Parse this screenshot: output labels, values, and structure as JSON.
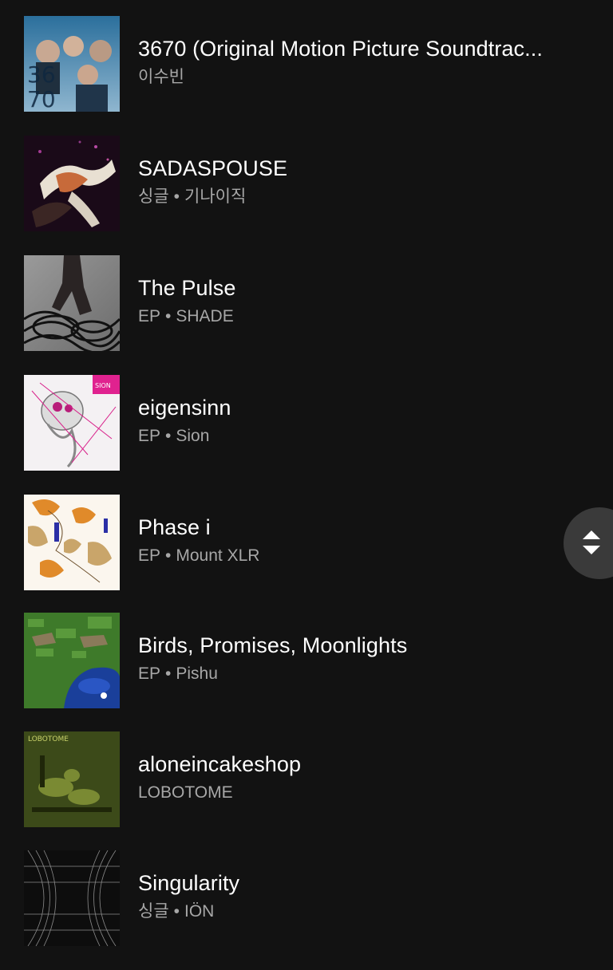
{
  "albums": [
    {
      "title": "3670 (Original Motion Picture Soundtrac...",
      "type": "",
      "artist": "이수빈",
      "cover_icon": "album-cover-3670"
    },
    {
      "title": "SADASPOUSE",
      "type": "싱글",
      "artist": "기나이직",
      "cover_icon": "album-cover-sadaspouse"
    },
    {
      "title": "The Pulse",
      "type": "EP",
      "artist": "SHADE",
      "cover_icon": "album-cover-the-pulse"
    },
    {
      "title": "eigensinn",
      "type": "EP",
      "artist": "Sion",
      "cover_icon": "album-cover-eigensinn"
    },
    {
      "title": "Phase i",
      "type": "EP",
      "artist": "Mount XLR",
      "cover_icon": "album-cover-phase-i"
    },
    {
      "title": "Birds, Promises, Moonlights",
      "type": "EP",
      "artist": "Pishu",
      "cover_icon": "album-cover-birds"
    },
    {
      "title": "aloneincakeshop",
      "type": "",
      "artist": "LOBOTOME",
      "cover_icon": "album-cover-aloneincakeshop"
    },
    {
      "title": "Singularity",
      "type": "싱글",
      "artist": "IÖN",
      "cover_icon": "album-cover-singularity"
    }
  ],
  "separator": "•",
  "cover_text": {
    "c3670": "36\n70",
    "lobotome": "LOBOTOME",
    "sion": "SION"
  },
  "scroll_handle_icon": "up-down-arrows-icon",
  "colors": {
    "background": "#121212",
    "title": "#ffffff",
    "subtitle": "#a7a7a7",
    "scroll_handle": "#3a3a3a"
  }
}
